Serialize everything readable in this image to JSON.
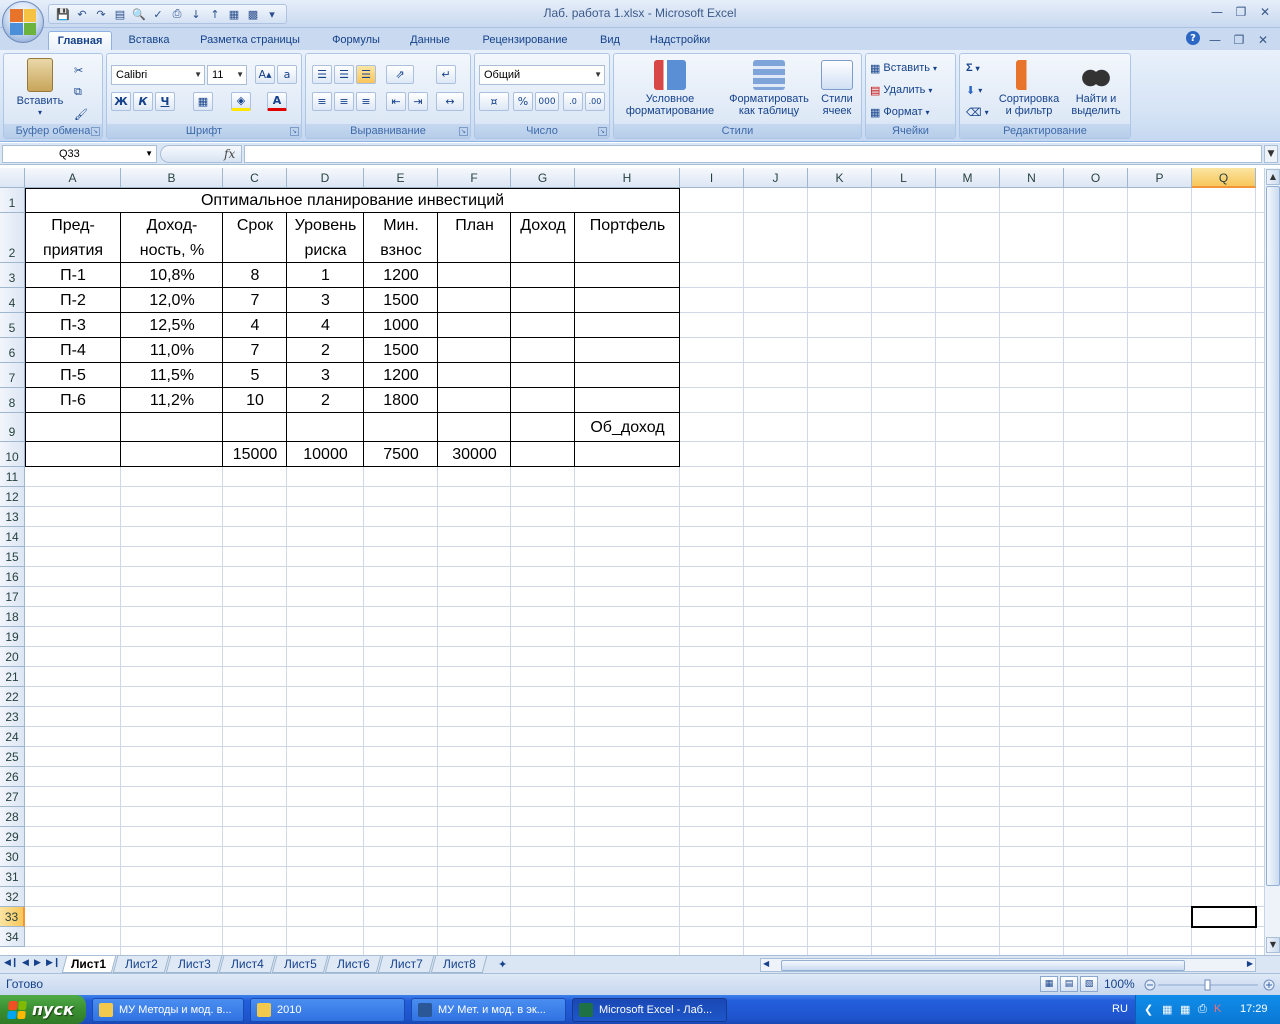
{
  "window": {
    "title": "Лаб. работа 1.xlsx - Microsoft Excel"
  },
  "tabs": [
    "Главная",
    "Вставка",
    "Разметка страницы",
    "Формулы",
    "Данные",
    "Рецензирование",
    "Вид",
    "Надстройки"
  ],
  "ribbon": {
    "clipboard": {
      "paste_label": "Вставить",
      "group_label": "Буфер обмена"
    },
    "font": {
      "name": "Calibri",
      "size": "11",
      "bold": "Ж",
      "italic": "К",
      "underline": "Ч",
      "group_label": "Шрифт"
    },
    "alignment": {
      "group_label": "Выравнивание"
    },
    "number": {
      "format": "Общий",
      "percent": "%",
      "thousands": "000",
      "group_label": "Число"
    },
    "styles": {
      "conditional_line1": "Условное",
      "conditional_line2": "форматирование",
      "format_table_line1": "Форматировать",
      "format_table_line2": "как таблицу",
      "cell_styles_line1": "Стили",
      "cell_styles_line2": "ячеек",
      "group_label": "Стили"
    },
    "cells": {
      "insert": "Вставить",
      "delete": "Удалить",
      "format": "Формат",
      "group_label": "Ячейки"
    },
    "editing": {
      "sort_line1": "Сортировка",
      "sort_line2": "и фильтр",
      "find_line1": "Найти и",
      "find_line2": "выделить",
      "group_label": "Редактирование"
    }
  },
  "formula_bar": {
    "name_box": "Q33",
    "fx": "fx",
    "value": ""
  },
  "columns": [
    "A",
    "B",
    "C",
    "D",
    "E",
    "F",
    "G",
    "H",
    "I",
    "J",
    "K",
    "L",
    "M",
    "N",
    "O",
    "P",
    "Q"
  ],
  "rows": [
    "1",
    "2",
    "3",
    "4",
    "5",
    "6",
    "7",
    "8",
    "9",
    "10",
    "11",
    "12",
    "13",
    "14",
    "15",
    "16",
    "17",
    "18",
    "19",
    "20",
    "21",
    "22",
    "23",
    "24",
    "25",
    "26",
    "27",
    "28",
    "29",
    "30",
    "31",
    "32",
    "33",
    "34"
  ],
  "table": {
    "title": "Оптимальное планирование инвестиций",
    "headers": [
      [
        "Пред-",
        "приятия"
      ],
      [
        "Доход-",
        "ность, %"
      ],
      [
        "Срок",
        ""
      ],
      [
        "Уровень",
        "риска"
      ],
      [
        "Мин.",
        "взнос"
      ],
      [
        "План",
        ""
      ],
      [
        "Доход",
        ""
      ],
      [
        "Портфель",
        ""
      ]
    ],
    "rows": [
      [
        "П-1",
        "10,8%",
        "8",
        "1",
        "1200"
      ],
      [
        "П-2",
        "12,0%",
        "7",
        "3",
        "1500"
      ],
      [
        "П-3",
        "12,5%",
        "4",
        "4",
        "1000"
      ],
      [
        "П-4",
        "11,0%",
        "7",
        "2",
        "1500"
      ],
      [
        "П-5",
        "11,5%",
        "5",
        "3",
        "1200"
      ],
      [
        "П-6",
        "11,2%",
        "10",
        "2",
        "1800"
      ]
    ],
    "row9_h": "Об_доход",
    "row10": [
      "15000",
      "10000",
      "7500",
      "30000"
    ]
  },
  "sheet_tabs": [
    "Лист1",
    "Лист2",
    "Лист3",
    "Лист4",
    "Лист5",
    "Лист6",
    "Лист7",
    "Лист8"
  ],
  "status": {
    "text": "Готово",
    "zoom": "100%"
  },
  "taskbar": {
    "start": "пуск",
    "items": [
      "МУ Методы и мод. в...",
      "2010",
      "МУ Мет. и мод. в эк...",
      "Microsoft Excel - Лаб..."
    ],
    "lang": "RU",
    "clock": "17:29"
  }
}
